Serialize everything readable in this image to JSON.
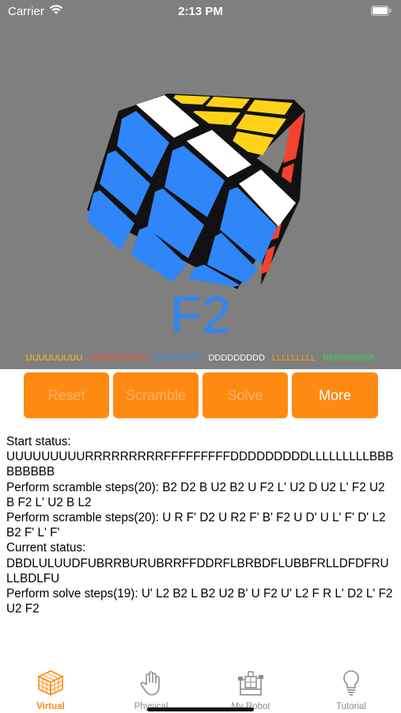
{
  "status_bar": {
    "carrier": "Carrier",
    "time": "2:13 PM"
  },
  "viewport": {
    "move_label": "F2",
    "face_strings": [
      {
        "text": "UUUUUUUUU",
        "color": "#f5c518"
      },
      {
        "text": "RRRRRRRRR",
        "color": "#f04a3a"
      },
      {
        "text": "FFFFFFFFF",
        "color": "#2f86f8"
      },
      {
        "text": "DDDDDDDDD",
        "color": "#ffffff"
      },
      {
        "text": "LLLLLLLLL",
        "color": "#ff9a1e"
      },
      {
        "text": "BBBBBBBBB",
        "color": "#43c95c"
      }
    ]
  },
  "buttons": {
    "reset": "Reset",
    "scramble": "Scramble",
    "solve": "Solve",
    "more": "More"
  },
  "log": {
    "lines": [
      "Start status:",
      "UUUUUUUUURRRRRRRRRFFFFFFFFFDDDDDDDDDLLLLLLLLLBBBBBBBBB",
      "Perform scramble steps(20): B2 D2 B U2 B2 U F2 L' U2 D U2 L' F2 U2 B F2 L' U2 B L2",
      "Perform scramble steps(20): U R F' D2 U R2 F' B' F2 U D' U L' F' D' L2 B2 F' L' F'",
      "Current status:",
      "DBDLULUUDFUBRRBURUBRRFFDDRFLBRBDFLUBBFRLLDFDFRULLBDLFU",
      "Perform solve steps(19): U' L2 B2 L B2 U2 B' U F2 U' L2 F R L' D2 L' F2 U2 F2"
    ]
  },
  "tabs": {
    "virtual": "Virtual",
    "physical": "Physical",
    "my_robot": "My Robot",
    "tutorial": "Tutorial"
  },
  "colors": {
    "accent": "#ff8a12",
    "viewport_bg": "#7f7f7f",
    "cube_blue": "#2f86f8",
    "cube_white": "#ffffff",
    "cube_yellow": "#ffd21a",
    "cube_red": "#f44230"
  }
}
